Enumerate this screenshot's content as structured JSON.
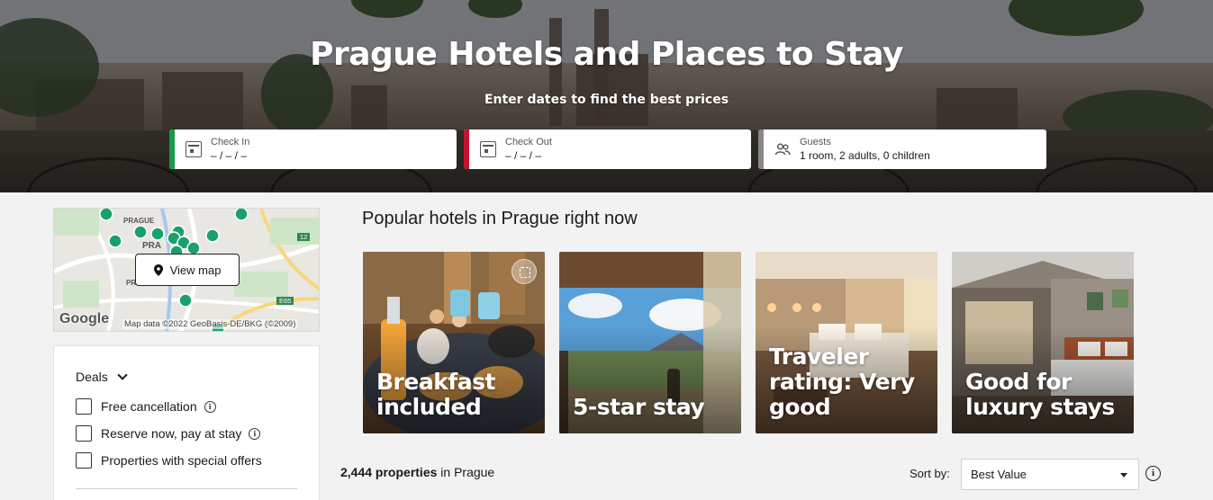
{
  "hero": {
    "title": "Prague Hotels and Places to Stay",
    "subtitle": "Enter dates to find the best prices",
    "check_in": {
      "label": "Check In",
      "value": "– / – / –",
      "accent": "#1a9a48"
    },
    "check_out": {
      "label": "Check Out",
      "value": "– / – / –",
      "accent": "#c8102e"
    },
    "guests": {
      "label": "Guests",
      "value": "1 room, 2 adults, 0 children",
      "accent": "#888888"
    }
  },
  "map": {
    "view_map_label": "View map",
    "attribution": "Map data ©2022 GeoBasis-DE/BKG (©2009)",
    "logo": "Google",
    "place_labels": [
      "PRAGUE",
      "PRA",
      "PRAGUE"
    ],
    "road_badges": [
      "12",
      "E65"
    ],
    "pin_color": "#1aa06e"
  },
  "filters": {
    "deals_label": "Deals",
    "options": [
      {
        "label": "Free cancellation",
        "info": true
      },
      {
        "label": "Reserve now, pay at stay",
        "info": true
      },
      {
        "label": "Properties with special offers",
        "info": false
      }
    ]
  },
  "popular": {
    "title": "Popular hotels in Prague right now",
    "cards": [
      {
        "caption": "Breakfast included"
      },
      {
        "caption": "5-star stay"
      },
      {
        "caption": "Traveler rating: Very good"
      },
      {
        "caption": "Good for luxury stays"
      }
    ]
  },
  "results": {
    "count": "2,444 properties",
    "location": " in Prague",
    "sort_label": "Sort by:",
    "sort_value": "Best Value"
  }
}
